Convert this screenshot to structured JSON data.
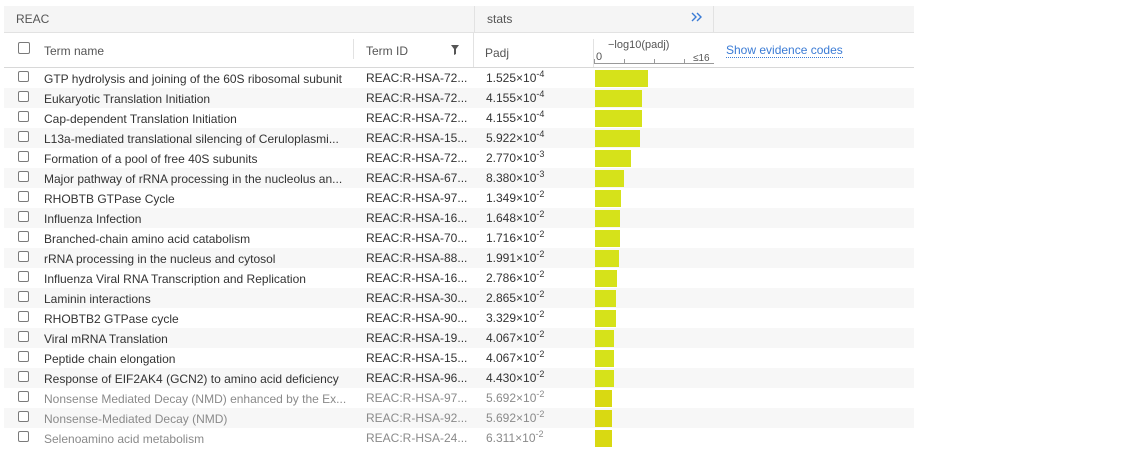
{
  "table": {
    "source_label": "REAC",
    "stats_label": "stats",
    "expand_icon": "double-chevron-right-icon",
    "columns": {
      "term_name": "Term name",
      "term_id": "Term ID",
      "padj": "Padj",
      "neglog_label": "−log10(padj)",
      "scale_min": "0",
      "scale_max": "≤16",
      "show_evidence": "Show evidence codes"
    },
    "accent_bar_color": "#d6e21a",
    "rows": [
      {
        "name": "GTP hydrolysis and joining of the 60S ribosomal subunit",
        "id": "REAC:R-HSA-72...",
        "padj_mant": "1.525×10",
        "padj_exp": "-4",
        "neglog": 3.82
      },
      {
        "name": "Eukaryotic Translation Initiation",
        "id": "REAC:R-HSA-72...",
        "padj_mant": "4.155×10",
        "padj_exp": "-4",
        "neglog": 3.38
      },
      {
        "name": "Cap-dependent Translation Initiation",
        "id": "REAC:R-HSA-72...",
        "padj_mant": "4.155×10",
        "padj_exp": "-4",
        "neglog": 3.38
      },
      {
        "name": "L13a-mediated translational silencing of Ceruloplasmi...",
        "id": "REAC:R-HSA-15...",
        "padj_mant": "5.922×10",
        "padj_exp": "-4",
        "neglog": 3.23
      },
      {
        "name": "Formation of a pool of free 40S subunits",
        "id": "REAC:R-HSA-72...",
        "padj_mant": "2.770×10",
        "padj_exp": "-3",
        "neglog": 2.56
      },
      {
        "name": "Major pathway of rRNA processing in the nucleolus an...",
        "id": "REAC:R-HSA-67...",
        "padj_mant": "8.380×10",
        "padj_exp": "-3",
        "neglog": 2.08
      },
      {
        "name": "RHOBTB GTPase Cycle",
        "id": "REAC:R-HSA-97...",
        "padj_mant": "1.349×10",
        "padj_exp": "-2",
        "neglog": 1.87
      },
      {
        "name": "Influenza Infection",
        "id": "REAC:R-HSA-16...",
        "padj_mant": "1.648×10",
        "padj_exp": "-2",
        "neglog": 1.78
      },
      {
        "name": "Branched-chain amino acid catabolism",
        "id": "REAC:R-HSA-70...",
        "padj_mant": "1.716×10",
        "padj_exp": "-2",
        "neglog": 1.77
      },
      {
        "name": "rRNA processing in the nucleus and cytosol",
        "id": "REAC:R-HSA-88...",
        "padj_mant": "1.991×10",
        "padj_exp": "-2",
        "neglog": 1.7
      },
      {
        "name": "Influenza Viral RNA Transcription and Replication",
        "id": "REAC:R-HSA-16...",
        "padj_mant": "2.786×10",
        "padj_exp": "-2",
        "neglog": 1.56
      },
      {
        "name": "Laminin interactions",
        "id": "REAC:R-HSA-30...",
        "padj_mant": "2.865×10",
        "padj_exp": "-2",
        "neglog": 1.54
      },
      {
        "name": "RHOBTB2 GTPase cycle",
        "id": "REAC:R-HSA-90...",
        "padj_mant": "3.329×10",
        "padj_exp": "-2",
        "neglog": 1.48
      },
      {
        "name": "Viral mRNA Translation",
        "id": "REAC:R-HSA-19...",
        "padj_mant": "4.067×10",
        "padj_exp": "-2",
        "neglog": 1.39
      },
      {
        "name": "Peptide chain elongation",
        "id": "REAC:R-HSA-15...",
        "padj_mant": "4.067×10",
        "padj_exp": "-2",
        "neglog": 1.39
      },
      {
        "name": "Response of EIF2AK4 (GCN2) to amino acid deficiency",
        "id": "REAC:R-HSA-96...",
        "padj_mant": "4.430×10",
        "padj_exp": "-2",
        "neglog": 1.35
      },
      {
        "name": "Nonsense Mediated Decay (NMD) enhanced by the Ex...",
        "id": "REAC:R-HSA-97...",
        "padj_mant": "5.692×10",
        "padj_exp": "-2",
        "neglog": 1.24,
        "muted": true
      },
      {
        "name": "Nonsense-Mediated Decay (NMD)",
        "id": "REAC:R-HSA-92...",
        "padj_mant": "5.692×10",
        "padj_exp": "-2",
        "neglog": 1.24,
        "muted": true
      },
      {
        "name": "Selenoamino acid metabolism",
        "id": "REAC:R-HSA-24...",
        "padj_mant": "6.311×10",
        "padj_exp": "-2",
        "neglog": 1.2,
        "muted": true
      }
    ]
  }
}
